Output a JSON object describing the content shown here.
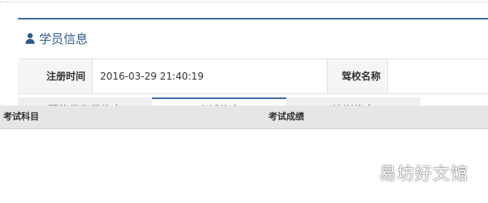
{
  "colors": {
    "accent": "#3c6ea5",
    "title": "#2f5b8a",
    "label_bg": "#f5f5f5",
    "tab_bg": "#f0f0f0",
    "table_header_bg": "#e6e6e6"
  },
  "panel": {
    "icon": "user-icon",
    "title": "学员信息"
  },
  "info": {
    "reg_time_label": "注册时间",
    "reg_time_value": "2016-03-29 21:40:19",
    "school_label": "驾校名称",
    "school_value": ""
  },
  "tabs": [
    {
      "label": "预约优先级信息",
      "active": false
    },
    {
      "label": "考试信息",
      "active": true
    },
    {
      "label": "培训信息",
      "active": false
    }
  ],
  "table": {
    "columns": [
      "考试科目",
      "考试成绩"
    ]
  },
  "watermark": "易坊好文馆"
}
